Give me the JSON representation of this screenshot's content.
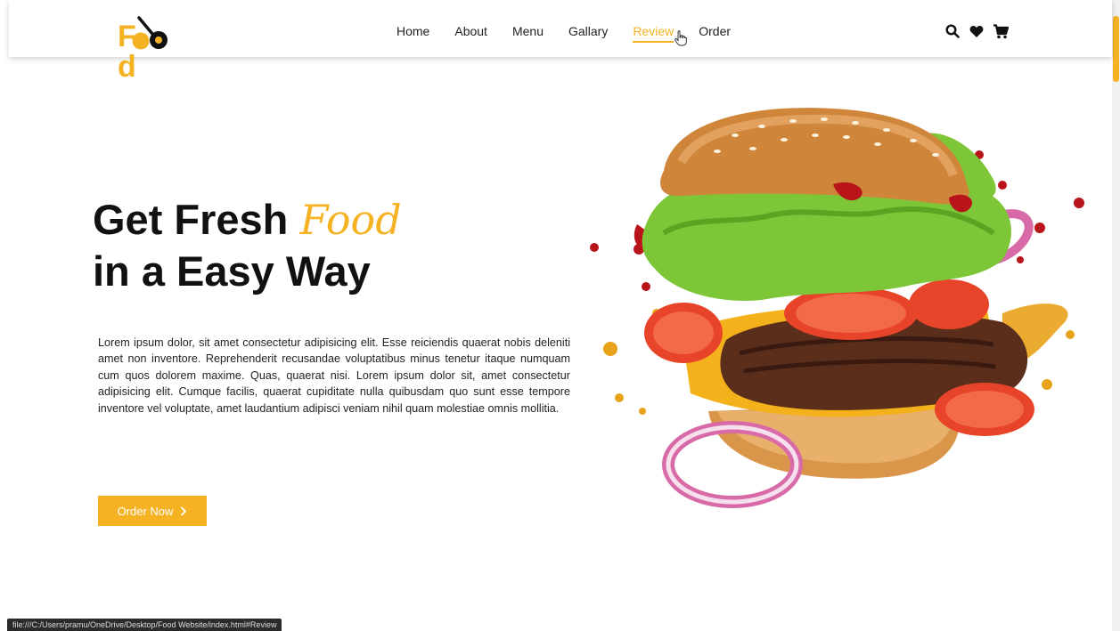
{
  "brand": {
    "logo_text_f": "F",
    "logo_text_d": "d",
    "accent_color": "#f5b324"
  },
  "nav": {
    "items": [
      {
        "label": "Home"
      },
      {
        "label": "About"
      },
      {
        "label": "Menu"
      },
      {
        "label": "Gallary"
      },
      {
        "label": "Review"
      },
      {
        "label": "Order"
      }
    ],
    "active": "Review"
  },
  "header_icons": [
    "search-icon",
    "heart-icon",
    "cart-icon"
  ],
  "hero": {
    "title_line1_prefix": "Get Fresh ",
    "title_line1_accent": "Food",
    "title_line2": "in a Easy Way",
    "paragraph": "Lorem ipsum dolor, sit amet consectetur adipisicing elit. Esse reiciendis quaerat nobis deleniti amet non inventore. Reprehenderit recusandae voluptatibus minus tenetur itaque numquam cum quos dolorem maxime. Quas, quaerat nisi. Lorem ipsum dolor sit, amet consectetur adipisicing elit. Cumque facilis, quaerat cupiditate nulla quibusdam quo sunt esse tempore inventore vel voluptate, amet laudantium adipisci veniam nihil quam molestiae omnis mollitia.",
    "button_label": "Order Now",
    "button_icon": "chevron-right-icon"
  },
  "status_bar": {
    "url": "file:///C:/Users/pramu/OneDrive/Desktop/Food Website/index.html#Review"
  }
}
